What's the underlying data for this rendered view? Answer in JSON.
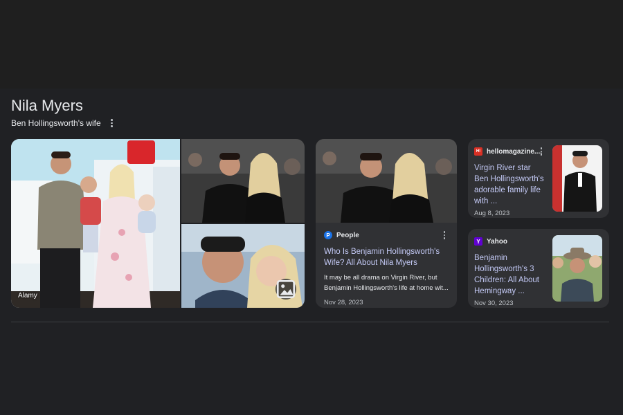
{
  "panel": {
    "title": "Nila Myers",
    "subtitle": "Ben Hollingsworth's wife",
    "main_photo_credit": "Alamy"
  },
  "cards": [
    {
      "source": "People",
      "favicon_letter": "P",
      "favicon_color": "#1a73e8",
      "title": "Who Is Benjamin Hollingsworth's Wife? All About Nila Myers",
      "snippet": "It may be all drama on Virgin River, but Benjamin Hollingsworth's life at home wit...",
      "date": "Nov 28, 2023"
    },
    {
      "source": "hellomagazine....",
      "favicon_letter": "H!",
      "favicon_color": "#d93025",
      "title": "Virgin River star Ben Hollingsworth's adorable family life with ...",
      "date": "Aug 8, 2023"
    },
    {
      "source": "Yahoo",
      "favicon_letter": "Y",
      "favicon_color": "#6001d2",
      "title": "Benjamin Hollingsworth's 3 Children: All About Hemingway ...",
      "date": "Nov 30, 2023"
    }
  ],
  "icons": {
    "more": "more-vert-icon",
    "image_search": "image-search-icon"
  }
}
